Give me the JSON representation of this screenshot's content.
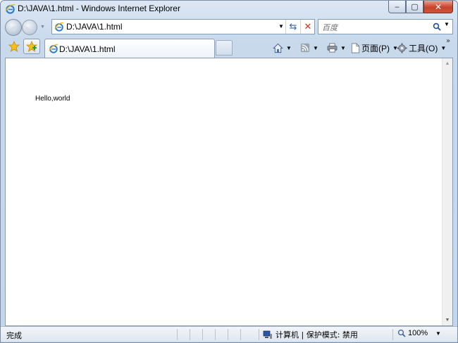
{
  "window": {
    "title": "D:\\JAVA\\1.html - Windows Internet Explorer",
    "caption": {
      "minimize": "‒",
      "maximize": "▢",
      "close": "✕"
    }
  },
  "nav": {
    "address": "D:\\JAVA\\1.html",
    "search_placeholder": "百度"
  },
  "tabs": [
    {
      "label": "D:\\JAVA\\1.html"
    }
  ],
  "commands": {
    "page_label": "页面(P)",
    "tools_label": "工具(O)",
    "more": "»"
  },
  "content": {
    "text": "Hello,world"
  },
  "status": {
    "text": "完成",
    "zone": "计算机 | 保护模式: 禁用",
    "zoom": "100%"
  },
  "colors": {
    "frame": "#c8d9ec",
    "close_button": "#c7432a",
    "address_border": "#7f9db9"
  }
}
